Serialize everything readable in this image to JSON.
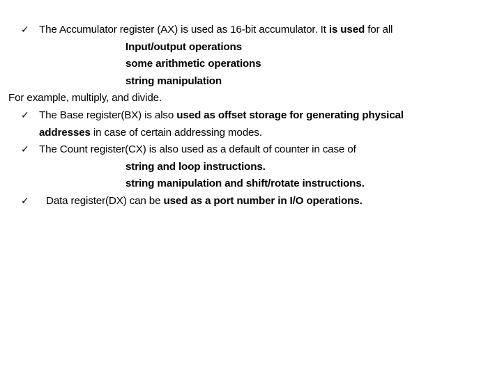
{
  "slide": {
    "background_color": "#ffffff",
    "text_color": "#000000",
    "bullet_glyph": "✓",
    "bullet_icon_name": "checkmark-bullet",
    "blocks": [
      {
        "id": "ax",
        "bullet": true,
        "lines": [
          {
            "indent": "bullet",
            "runs": [
              {
                "text": "The Accumulator register (AX) is used as 16-bit accumulator. It ",
                "bold": false
              },
              {
                "text": "is used",
                "bold": true
              },
              {
                "text": " for all",
                "bold": false
              }
            ]
          },
          {
            "indent": "sub",
            "runs": [
              {
                "text": "Input/output operations",
                "bold": true
              }
            ]
          },
          {
            "indent": "sub",
            "runs": [
              {
                "text": "some arithmetic operations",
                "bold": true
              }
            ]
          },
          {
            "indent": "sub",
            "runs": [
              {
                "text": "string manipulation",
                "bold": true
              }
            ]
          },
          {
            "indent": "example",
            "runs": [
              {
                "text": "For example, multiply, and divide.",
                "bold": false
              }
            ]
          }
        ]
      },
      {
        "id": "bx",
        "bullet": true,
        "lines": [
          {
            "indent": "bullet",
            "runs": [
              {
                "text": "The Base register(BX) is also ",
                "bold": false
              },
              {
                "text": "used as offset storage for generating physical",
                "bold": true
              }
            ]
          },
          {
            "indent": "cont",
            "runs": [
              {
                "text": "addresses",
                "bold": true
              },
              {
                "text": " in case of certain addressing modes.",
                "bold": false
              }
            ]
          }
        ]
      },
      {
        "id": "cx",
        "bullet": true,
        "lines": [
          {
            "indent": "bullet",
            "runs": [
              {
                "text": "The Count register(CX) is also used as a default of counter in case of",
                "bold": false
              }
            ]
          },
          {
            "indent": "sub",
            "runs": [
              {
                "text": "string and loop instructions.",
                "bold": true
              }
            ]
          },
          {
            "indent": "sub",
            "runs": [
              {
                "text": "string manipulation and shift/rotate instructions.",
                "bold": true
              }
            ]
          }
        ]
      },
      {
        "id": "dx",
        "bullet": true,
        "bullet_wide": true,
        "lines": [
          {
            "indent": "bullet-wide",
            "runs": [
              {
                "text": "Data register(DX) can be ",
                "bold": false
              },
              {
                "text": "used as a port number in I/O operations.",
                "bold": true
              }
            ]
          }
        ]
      }
    ]
  }
}
